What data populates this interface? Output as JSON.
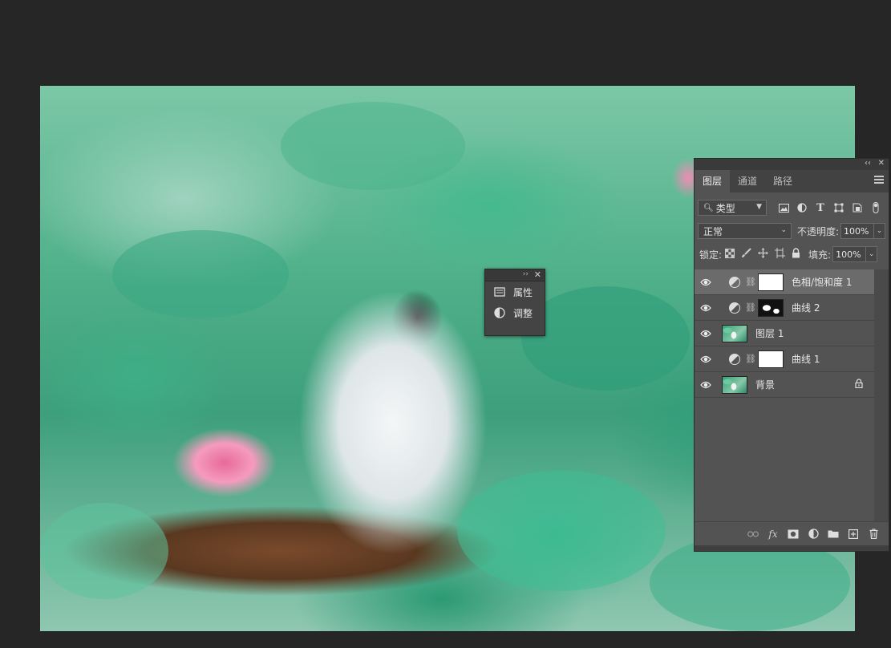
{
  "mini_panel": {
    "items": [
      {
        "label": "属性",
        "icon": "properties-icon"
      },
      {
        "label": "调整",
        "icon": "adjustments-icon"
      }
    ]
  },
  "layers_panel": {
    "tabs": [
      {
        "label": "图层",
        "active": true
      },
      {
        "label": "通道",
        "active": false
      },
      {
        "label": "路径",
        "active": false
      }
    ],
    "filter": {
      "label": "类型"
    },
    "blend_mode": "正常",
    "opacity": {
      "label": "不透明度:",
      "value": "100%"
    },
    "lock": {
      "label": "锁定:"
    },
    "fill": {
      "label": "填充:",
      "value": "100%"
    },
    "layers": [
      {
        "name": "色相/饱和度 1",
        "type": "adjustment",
        "mask": "white",
        "selected": true
      },
      {
        "name": "曲线 2",
        "type": "adjustment",
        "mask": "curve-mask",
        "selected": false
      },
      {
        "name": "图层 1",
        "type": "pixel",
        "selected": false
      },
      {
        "name": "曲线 1",
        "type": "adjustment",
        "mask": "white",
        "selected": false
      },
      {
        "name": "背景",
        "type": "background",
        "locked": true,
        "selected": false
      }
    ]
  },
  "colors": {
    "app_bg": "#262626",
    "panel_bg": "#535353",
    "selected_row": "#6b6b6b"
  }
}
